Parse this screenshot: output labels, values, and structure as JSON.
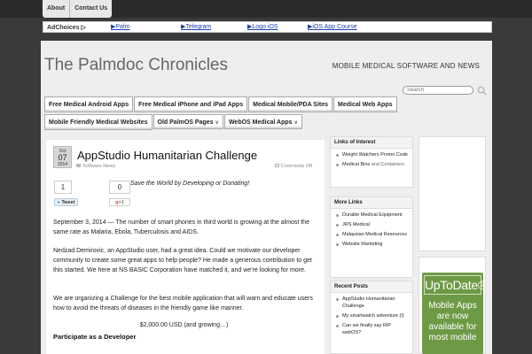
{
  "topnav": [
    {
      "label": "About"
    },
    {
      "label": "Contact Us"
    }
  ],
  "adbar": {
    "adchoices": "AdChoices ▷",
    "links": [
      {
        "label": "Palm"
      },
      {
        "label": "Telegram"
      },
      {
        "label": "Logo iOS"
      },
      {
        "label": "iOS App Course"
      }
    ]
  },
  "site": {
    "title": "The Palmdoc Chronicles",
    "tagline": "MOBILE MEDICAL SOFTWARE AND NEWS",
    "search_placeholder": "Search"
  },
  "categories": [
    {
      "label": "Free Medical Android Apps"
    },
    {
      "label": "Free Medical iPhone and iPad Apps"
    },
    {
      "label": "Medical Mobile/PDA Sites"
    },
    {
      "label": "Medical Web Apps"
    },
    {
      "label": "Mobile Friendly Medical Websites"
    },
    {
      "label": "Old PalmOS Pages",
      "dropdown": true
    },
    {
      "label": "WebOS Medical Apps",
      "dropdown": true
    }
  ],
  "post": {
    "date": {
      "month": "Oct",
      "day": "07",
      "year": "2014"
    },
    "title": "AppStudio Humanitarian Challenge",
    "category": "Software News",
    "comments": "Comments Off",
    "share": {
      "tweet_count": "1",
      "tweet_label": "Tweet",
      "gplus_count": "0",
      "gplus_label": "+1"
    },
    "slogan": "Save the World by Developing or Donating!",
    "p1": "September 3, 2014 — The number of smart phones in third world is growing at the almost the same rate as Malaria, Ebola, Tuberculosis and AIDS.",
    "p2": "Nedzad Demirovic, an AppStudio user, had a great idea. Could we motivate our developer community to create some great apps to help people? He made a generous contribution to get this started. We here at NS BASIC Corporation have matched it, and we're looking for more.",
    "p3": "We are organizing a Challenge for the best mobile application that will warn and educate users how to avoid the threats of diseases in the friendly game like manner.",
    "prize": "$2,000.00 USD (and growing…)",
    "subhead": "Participate as a Developer"
  },
  "sidebar": {
    "links_of_interest": {
      "title": "Links of Interest",
      "items": [
        {
          "label": "Weight Watchers Promo Code"
        },
        {
          "label": "Medical Bins",
          "suffix": " and Containers"
        }
      ]
    },
    "more_links": {
      "title": "More Links",
      "items": [
        {
          "label": "Durable Medical Equipment"
        },
        {
          "label": "JRS Medical"
        },
        {
          "label": "Malaysian Medical Resources"
        },
        {
          "label": "Website Marketing"
        }
      ]
    },
    "recent_posts": {
      "title": "Recent Posts",
      "items": [
        {
          "label": "AppStudio Humanitarian Challenge"
        },
        {
          "label": "My smartwatch adventure (I)"
        },
        {
          "label": "Can we finally say RIP webOS?"
        }
      ]
    }
  },
  "ad": {
    "logo": "UpToDate®",
    "lines": [
      "Mobile Apps",
      "are now",
      "available for",
      "most mobile"
    ],
    "brand_color": "#6e9a45"
  },
  "colors": {
    "background": "#3a3a3a",
    "page": "#eeeeee",
    "link": "#1a3eae"
  }
}
